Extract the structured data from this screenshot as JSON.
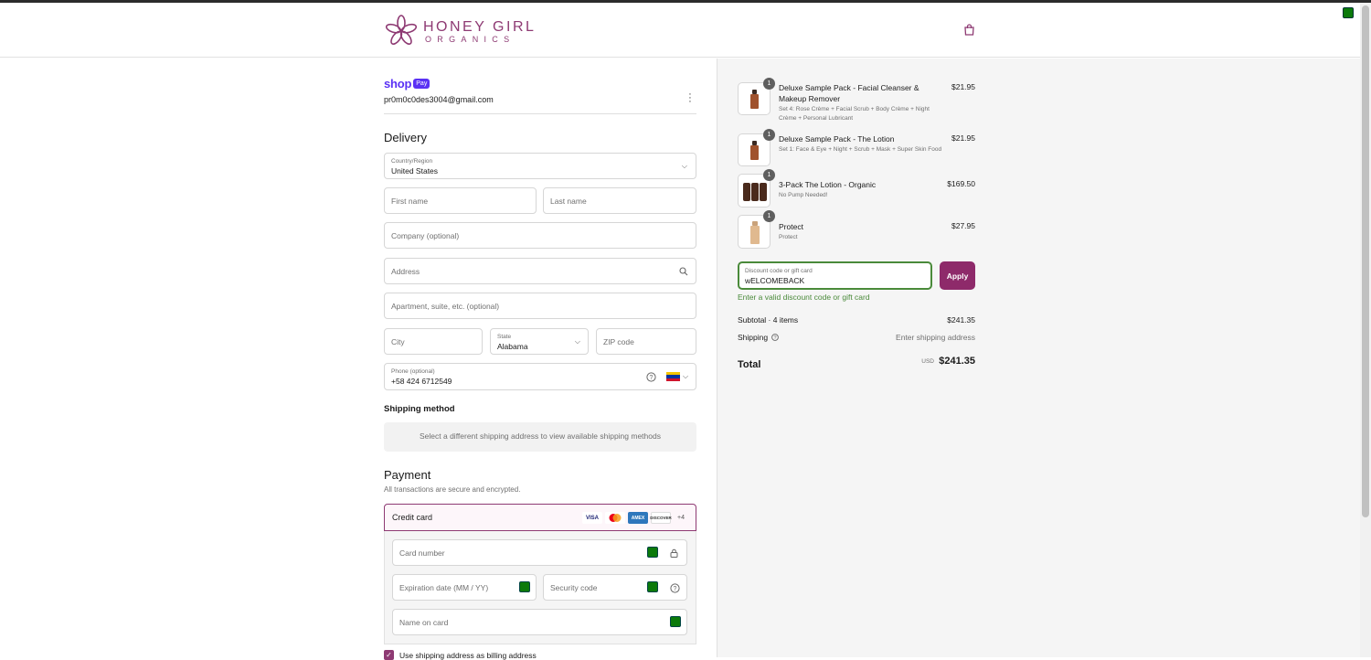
{
  "brand": {
    "name_line1": "HONEY GIRL",
    "name_line2": "ORGANICS",
    "accent_color": "#8e3a73",
    "cart_icon": "shopping-bag-icon"
  },
  "account": {
    "shop_label": "shop",
    "pay_badge": "Pay",
    "email": "pr0m0c0des3004@gmail.com",
    "menu_icon": "kebab-menu-icon"
  },
  "delivery": {
    "title": "Delivery",
    "country_label": "Country/Region",
    "country_value": "United States",
    "first_name_placeholder": "First name",
    "last_name_placeholder": "Last name",
    "company_placeholder": "Company (optional)",
    "address_placeholder": "Address",
    "apartment_placeholder": "Apartment, suite, etc. (optional)",
    "city_placeholder": "City",
    "state_label": "State",
    "state_value": "Alabama",
    "zip_placeholder": "ZIP code",
    "phone_label": "Phone (optional)",
    "phone_value": "+58 424 6712549"
  },
  "shipping_method": {
    "title": "Shipping method",
    "message": "Select a different shipping address to view available shipping methods"
  },
  "payment": {
    "title": "Payment",
    "subtitle": "All transactions are secure and encrypted.",
    "method_label": "Credit card",
    "card_brands": [
      "VISA",
      "MC",
      "AMEX",
      "DISCOVER"
    ],
    "more_brands": "+4",
    "card_number_placeholder": "Card number",
    "expiration_placeholder": "Expiration date (MM / YY)",
    "security_placeholder": "Security code",
    "name_placeholder": "Name on card",
    "billing_same_label": "Use shipping address as billing address",
    "billing_same_checked": true
  },
  "order": {
    "items": [
      {
        "qty": "1",
        "name": "Deluxe Sample Pack - Facial Cleanser & Makeup Remover",
        "desc": "Set 4: Rose Crème + Facial Scrub + Body Crème + Night Crème + Personal Lubricant",
        "price": "$21.95"
      },
      {
        "qty": "1",
        "name": "Deluxe Sample Pack - The Lotion",
        "desc": "Set 1: Face & Eye + Night + Scrub + Mask + Super Skin Food",
        "price": "$21.95"
      },
      {
        "qty": "1",
        "name": "3-Pack The Lotion - Organic",
        "desc": "No Pump Needed!",
        "price": "$169.50"
      },
      {
        "qty": "1",
        "name": "Protect",
        "desc": "Protect",
        "price": "$27.95"
      }
    ],
    "discount_label": "Discount code or gift card",
    "discount_value": "wELCOMEBACK",
    "apply_label": "Apply",
    "discount_error": "Enter a valid discount code or gift card",
    "subtotal_label": "Subtotal · 4 items",
    "subtotal_value": "$241.35",
    "shipping_label": "Shipping",
    "shipping_value": "Enter shipping address",
    "total_label": "Total",
    "currency": "USD",
    "total_value": "$241.35"
  }
}
